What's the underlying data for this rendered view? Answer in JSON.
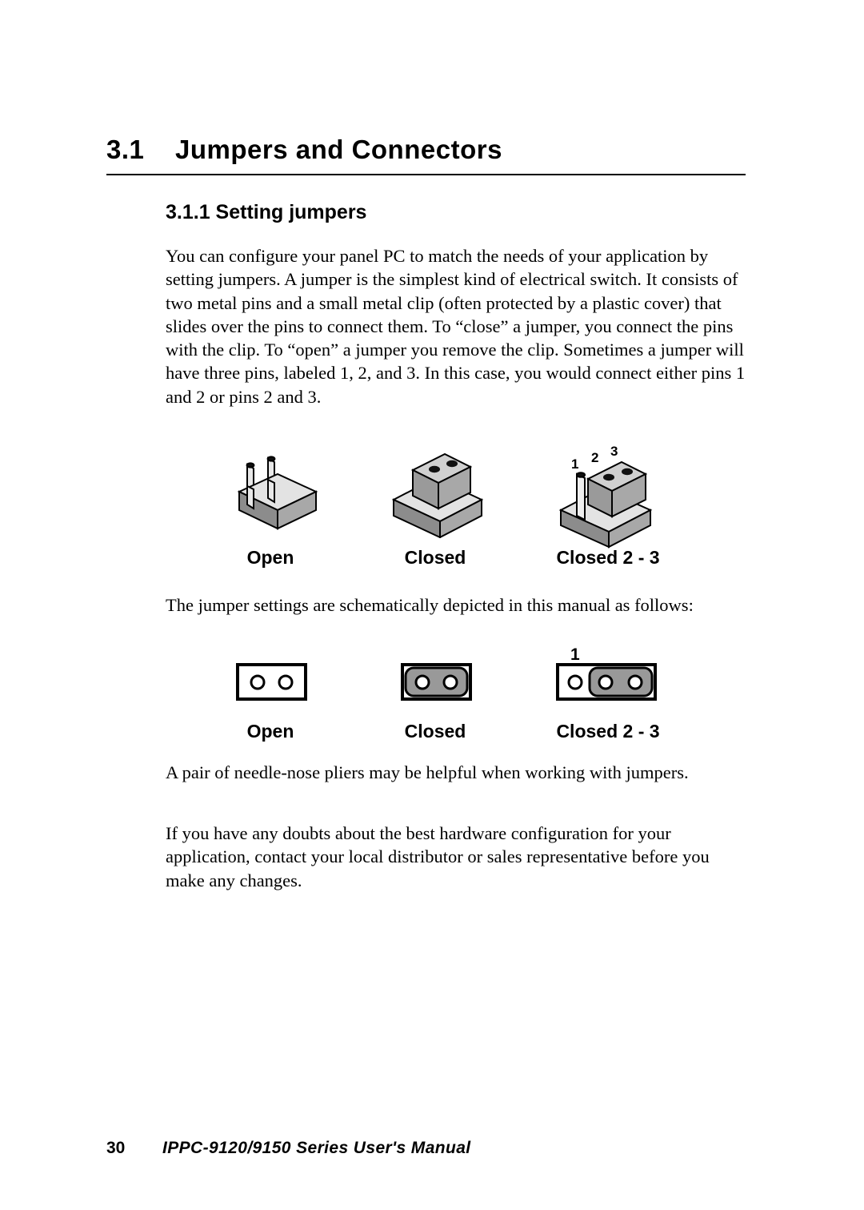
{
  "document": {
    "section_number": "3.1",
    "section_title": "Jumpers and Connectors",
    "subsection_title": "3.1.1 Setting jumpers"
  },
  "paragraphs": {
    "intro": "You can configure your panel PC to match the needs of your application by setting jumpers. A jumper is the simplest kind of electrical switch. It consists of two metal pins and a small metal clip (often protected by a plastic cover) that slides over the pins to connect them. To “close” a jumper, you connect the pins with the clip. To “open” a jumper you remove the clip. Sometimes a jumper will have three pins, labeled 1, 2, and 3. In this case, you would connect either pins 1 and 2 or pins 2 and 3.",
    "schematic_intro": "The jumper settings are schematically depicted in this manual as follows:",
    "pliers": "A pair of needle-nose pliers may be helpful when working with jumpers.",
    "doubts": "If you have any doubts about the best hardware configuration for your application, contact your local distributor or sales representative before you make any changes."
  },
  "figures": {
    "illustration_row": {
      "items": [
        {
          "caption": "Open",
          "icon": "jumper-open-3d-icon"
        },
        {
          "caption": "Closed",
          "icon": "jumper-closed-3d-icon"
        },
        {
          "caption": "Closed 2 - 3",
          "icon": "jumper-closed-2-3-3d-icon"
        }
      ],
      "pin_labels": [
        "1",
        "2",
        "3"
      ]
    },
    "schematic_row": {
      "items": [
        {
          "caption": "Open",
          "icon": "jumper-open-schematic-icon"
        },
        {
          "caption": "Closed",
          "icon": "jumper-closed-schematic-icon"
        },
        {
          "caption": "Closed 2 - 3",
          "icon": "jumper-closed-2-3-schematic-icon"
        }
      ],
      "pin_one_label": "1"
    }
  },
  "footer": {
    "page_number": "30",
    "manual_title": "IPPC-9120/9150 Series User's Manual"
  },
  "colors": {
    "ink": "#000000",
    "paper": "#ffffff",
    "shade_light": "#e3e3e3",
    "shade_mid": "#a8a8a8",
    "shade_dark": "#8c8c8c",
    "cap_gray": "#999999"
  }
}
